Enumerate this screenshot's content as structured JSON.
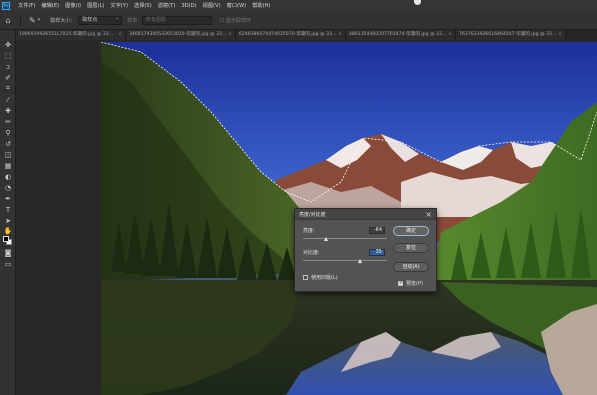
{
  "menubar": {
    "logo_text": "Ps",
    "items": [
      "文件(F)",
      "编辑(E)",
      "图像(I)",
      "图层(L)",
      "文字(Y)",
      "选择(S)",
      "滤镜(T)",
      "3D(D)",
      "视图(V)",
      "窗口(W)",
      "帮助(H)"
    ]
  },
  "options": {
    "sample_label": "取样大小：",
    "sample_value": "取样点",
    "sample_input_placeholder": "所有图层",
    "show_ring_label": "显示取样环"
  },
  "tabs": [
    {
      "label": "1986919926551L7025-华黛的.jpg @ 33...",
      "active": false
    },
    {
      "label": "3468179300532653020-华黛的.jpg @ 33...",
      "active": false
    },
    {
      "label": "6240386074474035070-华黛的.jpg @ 33...",
      "active": false
    },
    {
      "label": "4861354460297765474-华黛的.jpg @ 33...",
      "active": false
    },
    {
      "label": "7627633926616464547-华黛的.jpg @ 33...",
      "active": false
    }
  ],
  "dialog": {
    "title": "亮度/对比度",
    "brightness_label": "亮度:",
    "brightness_value": "-64",
    "contrast_label": "对比度:",
    "contrast_value": "35",
    "legacy_label": "使用旧版(L)",
    "legacy_checked": false,
    "preview_label": "预览(P)",
    "preview_checked": true,
    "ok_label": "确定",
    "reset_label": "复位",
    "auto_label": "自动(A)"
  },
  "colors": {
    "foreground": "#000000",
    "background": "#ffffff",
    "accent": "#31a8ff"
  },
  "tools": [
    "move-tool",
    "marquee-tool",
    "lasso-tool",
    "quick-select-tool",
    "crop-tool",
    "frame-tool",
    "eyedropper-tool",
    "healing-tool",
    "brush-tool",
    "clone-stamp-tool",
    "history-brush-tool",
    "eraser-tool",
    "gradient-tool",
    "blur-tool",
    "dodge-tool",
    "pen-tool",
    "type-tool",
    "path-select-tool",
    "rectangle-tool",
    "hand-tool",
    "zoom-tool",
    "edit-toolbar",
    "swap-colors",
    "quick-mask",
    "screen-mode"
  ]
}
